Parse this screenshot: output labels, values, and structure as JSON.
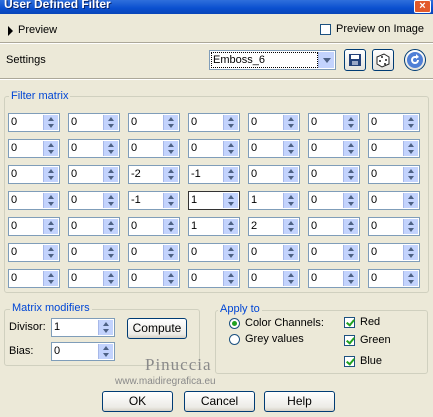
{
  "window": {
    "title": "User Defined Filter",
    "close_glyph": "×"
  },
  "preview": {
    "label": "Preview",
    "preview_on_image_label": "Preview on Image",
    "preview_on_image_checked": false
  },
  "settings": {
    "label": "Settings",
    "preset_value": "Emboss_6"
  },
  "filter_matrix": {
    "label": "Filter matrix",
    "rows": [
      [
        "0",
        "0",
        "0",
        "0",
        "0",
        "0",
        "0"
      ],
      [
        "0",
        "0",
        "0",
        "0",
        "0",
        "0",
        "0"
      ],
      [
        "0",
        "0",
        "-2",
        "-1",
        "0",
        "0",
        "0"
      ],
      [
        "0",
        "0",
        "-1",
        "1",
        "1",
        "0",
        "0"
      ],
      [
        "0",
        "0",
        "0",
        "1",
        "2",
        "0",
        "0"
      ],
      [
        "0",
        "0",
        "0",
        "0",
        "0",
        "0",
        "0"
      ],
      [
        "0",
        "0",
        "0",
        "0",
        "0",
        "0",
        "0"
      ]
    ]
  },
  "matrix_modifiers": {
    "label": "Matrix modifiers",
    "divisor_label": "Divisor:",
    "divisor_value": "1",
    "bias_label": "Bias:",
    "bias_value": "0",
    "compute_label": "Compute"
  },
  "apply_to": {
    "label": "Apply to",
    "color_channels_label": "Color Channels:",
    "grey_values_label": "Grey values",
    "selected": "color_channels",
    "red_label": "Red",
    "green_label": "Green",
    "blue_label": "Blue",
    "red_checked": true,
    "green_checked": true,
    "blue_checked": true
  },
  "watermark": {
    "name": "Pinuccia",
    "url": "www.maidiregrafica.eu"
  },
  "buttons": {
    "ok": "OK",
    "cancel": "Cancel",
    "help": "Help"
  },
  "icons": {
    "save": "save-icon",
    "dice": "randomize-icon",
    "reset": "reset-arrow-icon"
  }
}
